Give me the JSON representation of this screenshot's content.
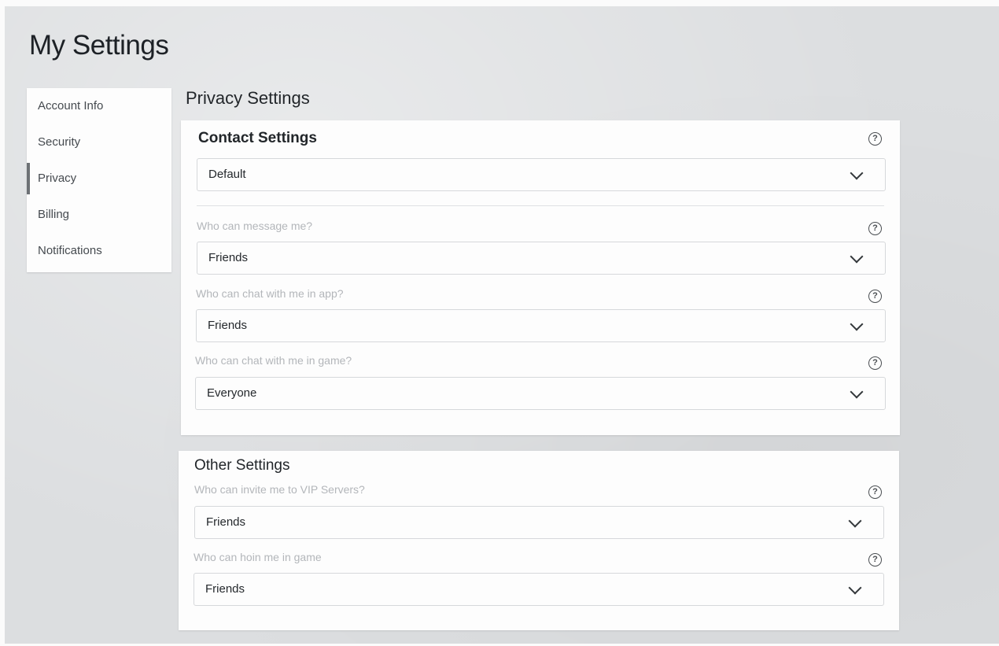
{
  "page": {
    "title": "My Settings"
  },
  "sidebar": {
    "items": [
      {
        "label": "Account Info",
        "active": false
      },
      {
        "label": "Security",
        "active": false
      },
      {
        "label": "Privacy",
        "active": true
      },
      {
        "label": "Billing",
        "active": false
      },
      {
        "label": "Notifications",
        "active": false
      }
    ]
  },
  "privacy": {
    "title": "Privacy Settings",
    "contact": {
      "heading": "Contact Settings",
      "default_select": "Default",
      "fields": [
        {
          "label": "Who can message me?",
          "value": "Friends"
        },
        {
          "label": "Who can chat with me in app?",
          "value": "Friends"
        },
        {
          "label": "Who can chat with me in game?",
          "value": "Everyone"
        }
      ]
    },
    "other": {
      "heading": "Other Settings",
      "fields": [
        {
          "label": "Who can invite me to VIP Servers?",
          "value": "Friends"
        },
        {
          "label": "Who can hoin me in game",
          "value": "Friends"
        }
      ]
    }
  },
  "icons": {
    "help": "help-circle-icon",
    "chevron": "chevron-down-icon"
  },
  "colors": {
    "background": "#dcdee0",
    "panel": "#fdfdfd",
    "label_muted": "#b3b6ba",
    "active_indicator": "#6d7175"
  }
}
